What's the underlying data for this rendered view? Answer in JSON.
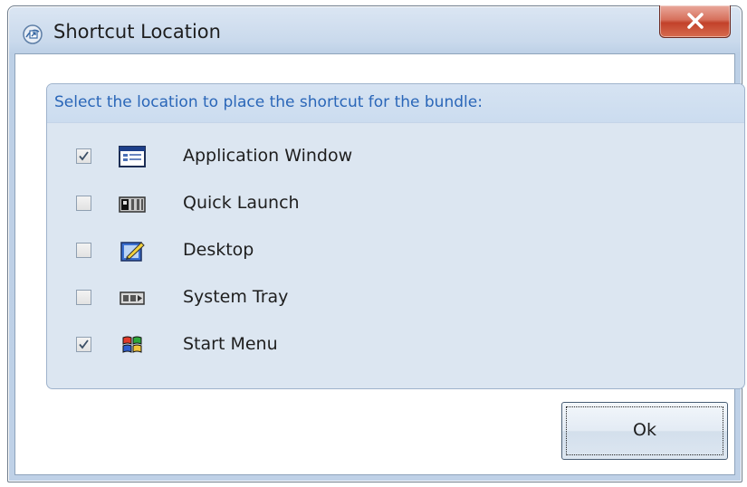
{
  "window": {
    "title": "Shortcut Location",
    "title_icon": "shortcut-bundle-icon",
    "close_icon": "close-x-icon"
  },
  "group": {
    "header": "Select the location to place the shortcut for the bundle:"
  },
  "options": [
    {
      "label": "Application Window",
      "checked": true,
      "icon": "application-window-icon"
    },
    {
      "label": "Quick Launch",
      "checked": false,
      "icon": "quick-launch-icon"
    },
    {
      "label": "Desktop",
      "checked": false,
      "icon": "desktop-icon"
    },
    {
      "label": "System Tray",
      "checked": false,
      "icon": "system-tray-icon"
    },
    {
      "label": "Start Menu",
      "checked": true,
      "icon": "start-menu-icon"
    }
  ],
  "buttons": {
    "ok_label": "Ok"
  },
  "colors": {
    "header_text": "#2a66b8",
    "close_button": "#c2412a",
    "panel_background": "#dce6f1"
  }
}
